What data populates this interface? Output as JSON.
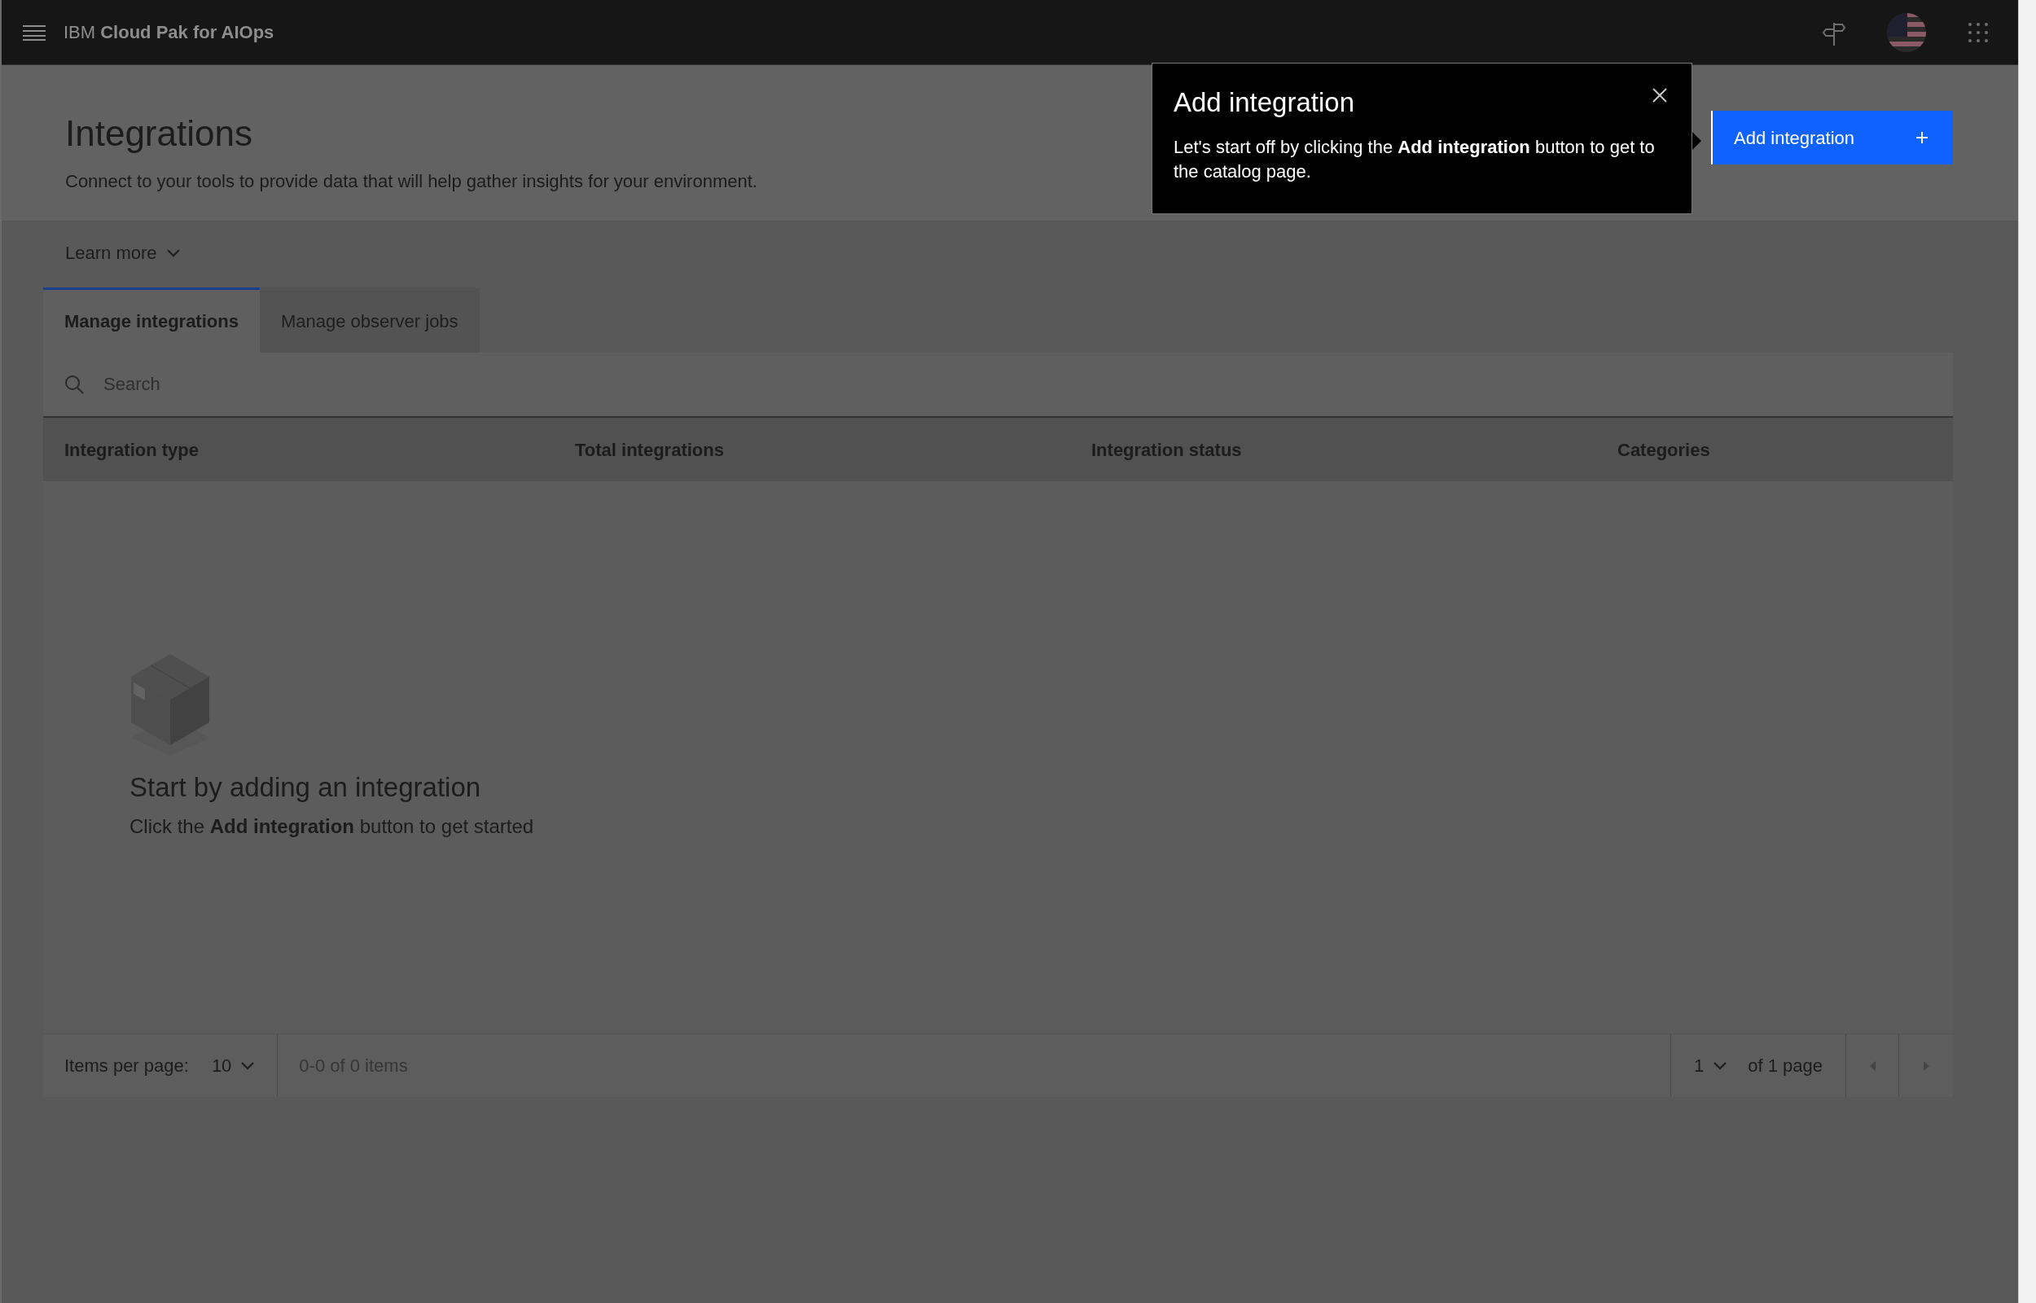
{
  "topbar": {
    "product_prefix": "IBM",
    "product_name": "Cloud Pak for AIOps"
  },
  "page": {
    "title": "Integrations",
    "description": "Connect to your tools to provide data that will help gather insights for your environment.",
    "learn_more": "Learn more"
  },
  "primary_button": {
    "label": "Add integration"
  },
  "tooltip": {
    "title": "Add integration",
    "body": "Let's start off by clicking the **Add integration** button to get to the catalog page."
  },
  "tabs": [
    {
      "label": "Manage integrations",
      "selected": true
    },
    {
      "label": "Manage observer jobs",
      "selected": false
    }
  ],
  "search": {
    "placeholder": "Search"
  },
  "table": {
    "columns": [
      "Integration type",
      "Total integrations",
      "Integration status",
      "Categories"
    ]
  },
  "empty_state": {
    "title": "Start by adding an integration",
    "body": "Click the **Add integration** button to get started"
  },
  "pagination": {
    "items_per_page_label": "Items per page:",
    "items_per_page": "10",
    "range": "0-0 of 0 items",
    "page": "1",
    "page_total": "of 1 page"
  }
}
